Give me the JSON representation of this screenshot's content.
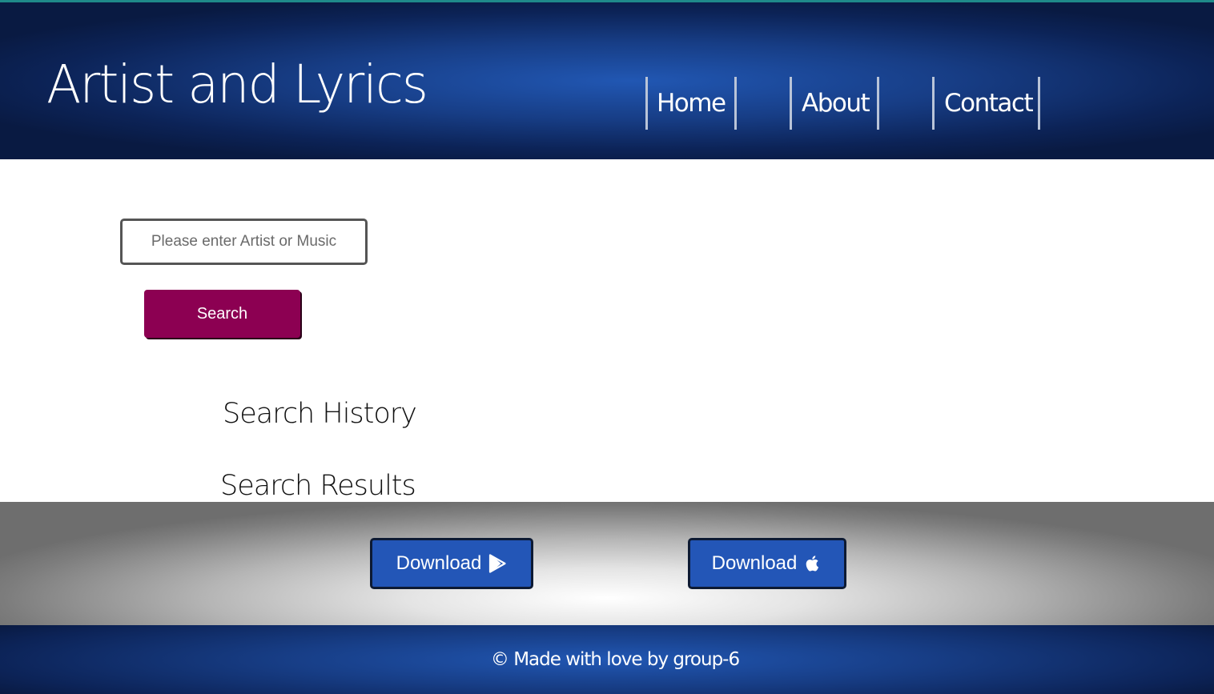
{
  "header": {
    "title": "Artist and Lyrics",
    "nav": {
      "home": "Home",
      "about": "About",
      "contact": "Contact"
    }
  },
  "search": {
    "placeholder": "Please enter Artist or Music",
    "value": "",
    "button_label": "Search"
  },
  "sections": {
    "history_heading": "Search History",
    "results_heading": "Search Results"
  },
  "downloads": {
    "android_label": "Download",
    "android_icon": "google-play-icon",
    "apple_label": "Download",
    "apple_icon": "apple-icon"
  },
  "footer": {
    "text": "© Made with love by group-6"
  },
  "colors": {
    "header_bg": "#173d85",
    "search_button": "#8c0052",
    "download_button": "#2356b7"
  }
}
